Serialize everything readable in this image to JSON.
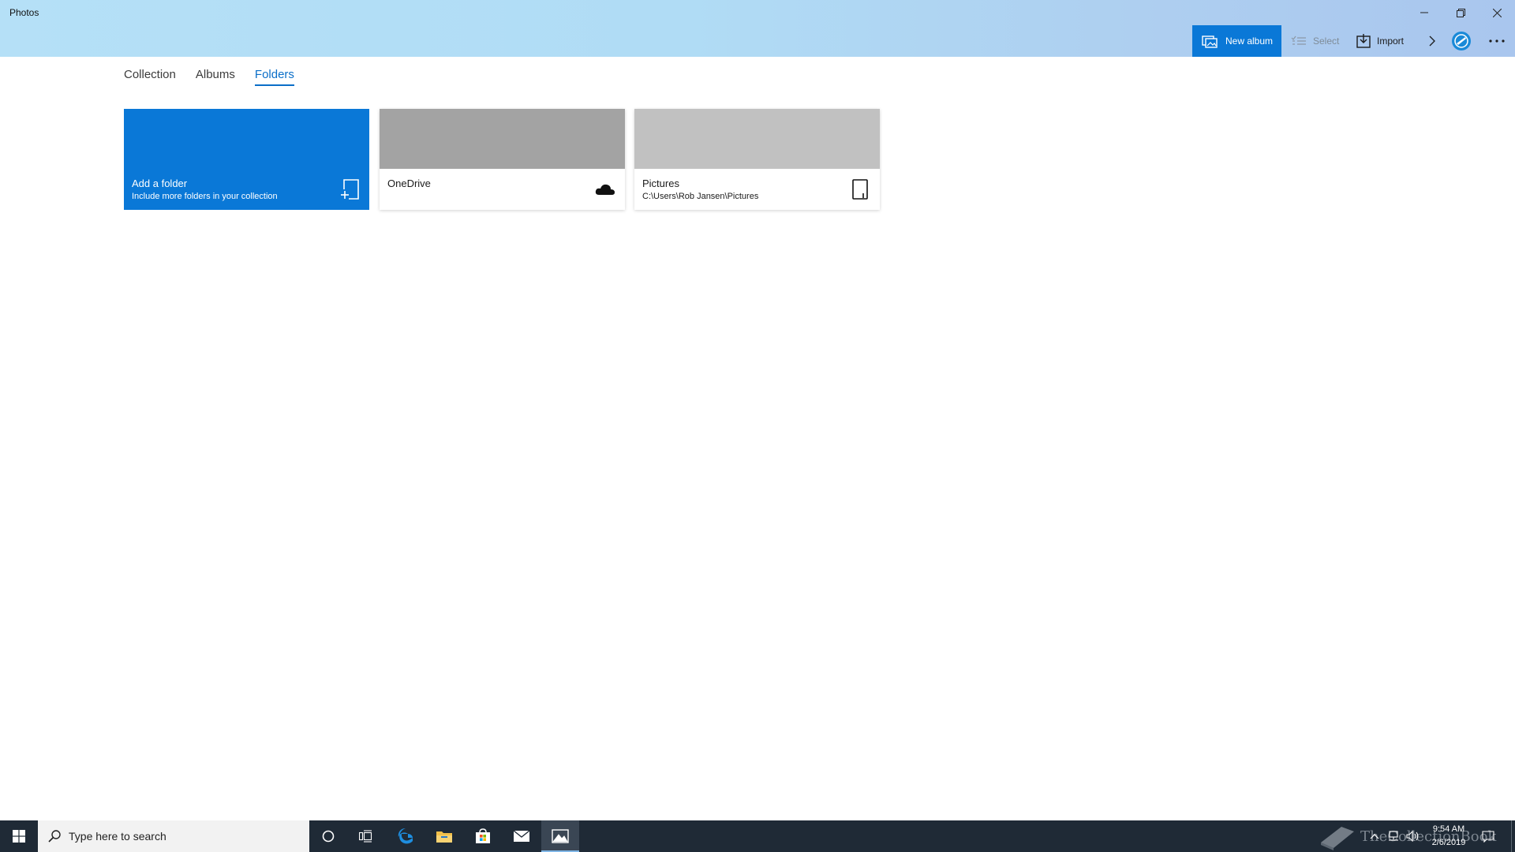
{
  "window": {
    "title": "Photos",
    "minimize_icon": "minimize-icon",
    "restore_icon": "restore-icon",
    "close_icon": "close-icon"
  },
  "toolbar": {
    "new_album_label": "New album",
    "select_label": "Select",
    "import_label": "Import",
    "accent_color": "#0a78d7"
  },
  "tabs": [
    {
      "label": "Collection",
      "active": false
    },
    {
      "label": "Albums",
      "active": false
    },
    {
      "label": "Folders",
      "active": true
    }
  ],
  "folders": {
    "add": {
      "title": "Add a folder",
      "subtitle": "Include more folders in your collection"
    },
    "items": [
      {
        "name": "OneDrive",
        "path": "",
        "icon": "cloud-icon"
      },
      {
        "name": "Pictures",
        "path": "C:\\Users\\Rob Jansen\\Pictures",
        "icon": "device-icon"
      }
    ]
  },
  "taskbar": {
    "search_placeholder": "Type here to search",
    "time": "9:54 AM",
    "date": "2/6/2019",
    "watermark": "TheCollectionBook"
  }
}
